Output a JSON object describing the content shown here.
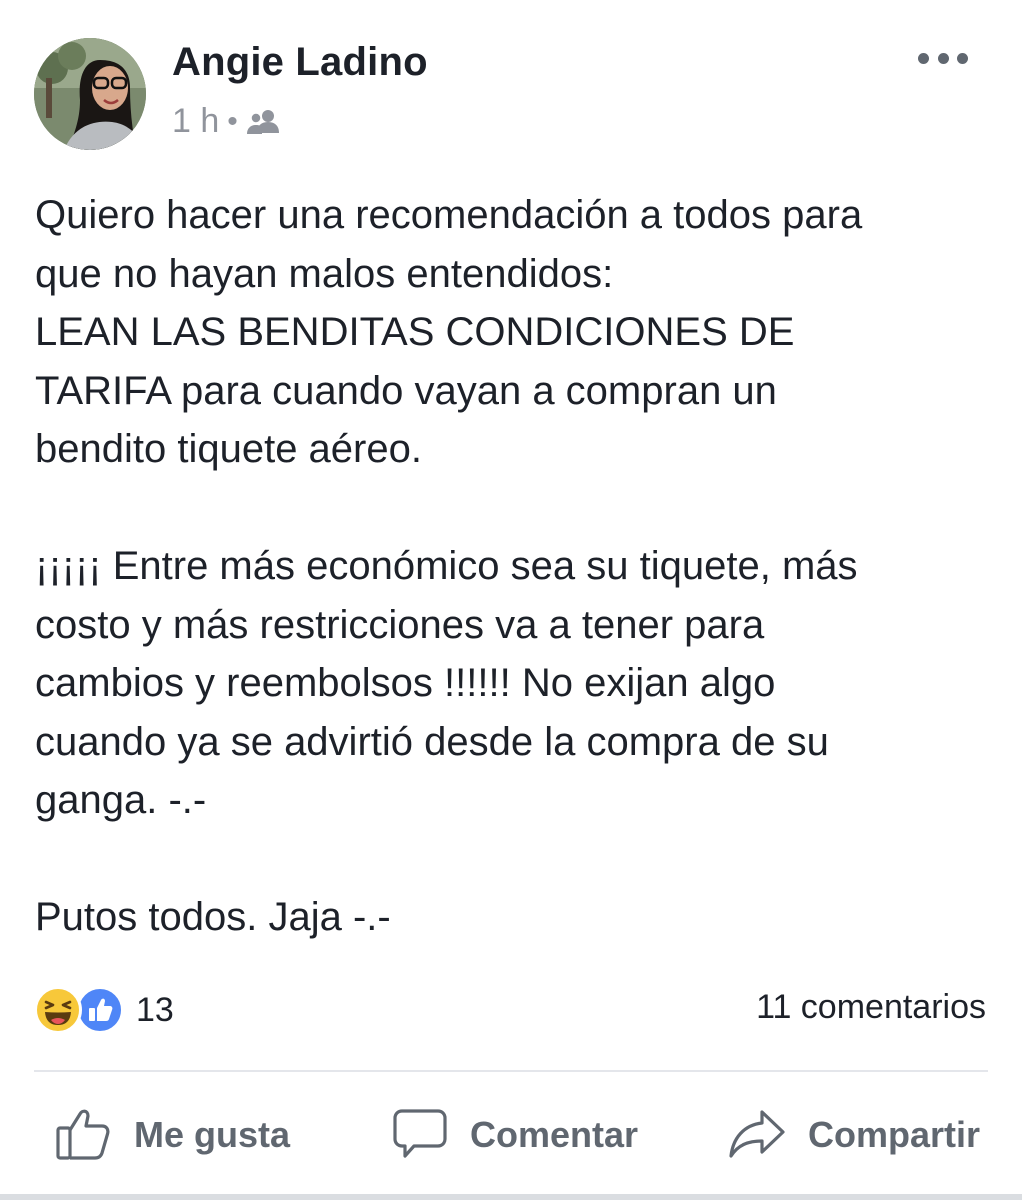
{
  "post": {
    "author": "Angie Ladino",
    "time": "1 h",
    "separator": "•",
    "audience_icon": "friends-icon",
    "more_icon": "more-options-icon",
    "paragraphs": [
      "Quiero hacer una recomendación a todos para\nque no hayan malos entendidos:\nLEAN LAS BENDITAS CONDICIONES DE\nTARIFA para cuando vayan a compran un\nbendito tiquete aéreo.",
      "¡¡¡¡¡ Entre más económico sea su tiquete, más\ncosto y más restricciones va a tener para\ncambios y reembolsos !!!!!! No exijan algo\ncuando ya se advirtió desde la compra de su\nganga. -.-",
      "Putos todos. Jaja -.-"
    ],
    "reactions": {
      "icons": [
        "haha-reaction-icon",
        "like-reaction-icon"
      ],
      "count": "13"
    },
    "comments_count": "11 comentarios"
  },
  "actions": {
    "like": {
      "label": "Me gusta",
      "icon": "thumbs-up-icon"
    },
    "comment": {
      "label": "Comentar",
      "icon": "speech-bubble-icon"
    },
    "share": {
      "label": "Compartir",
      "icon": "share-arrow-icon"
    }
  },
  "colors": {
    "text": "#1d2129",
    "secondary": "#90949c",
    "action_gray": "#606770",
    "haha_yellow": "#f7c83a",
    "like_blue": "#4f86f7"
  }
}
